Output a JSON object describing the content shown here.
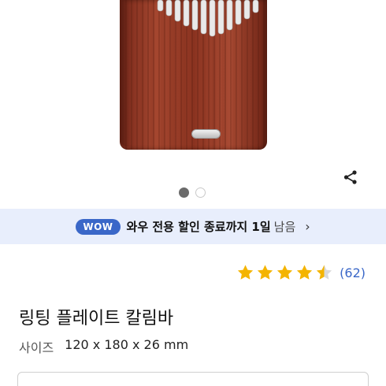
{
  "product_image": {
    "alt": "kalimba",
    "brand_plate_color": "#cfcfcf",
    "wood_color": "#9a3e29"
  },
  "gallery": {
    "total": 2,
    "active_index": 0
  },
  "share_icon": "share-icon",
  "wow_banner": {
    "badge": "WOW",
    "text": "와우 전용 할인 종료까지 1일",
    "suffix": "남음",
    "accent": "#3a67c8",
    "background": "#e8eefc"
  },
  "rating": {
    "stars": 4.5,
    "review_count": "(62)",
    "star_color": "#f4b400"
  },
  "product": {
    "title": "링팅 플레이트 칼림바",
    "size_label": "사이즈",
    "size_value": "120 x 180 x 26 mm"
  }
}
